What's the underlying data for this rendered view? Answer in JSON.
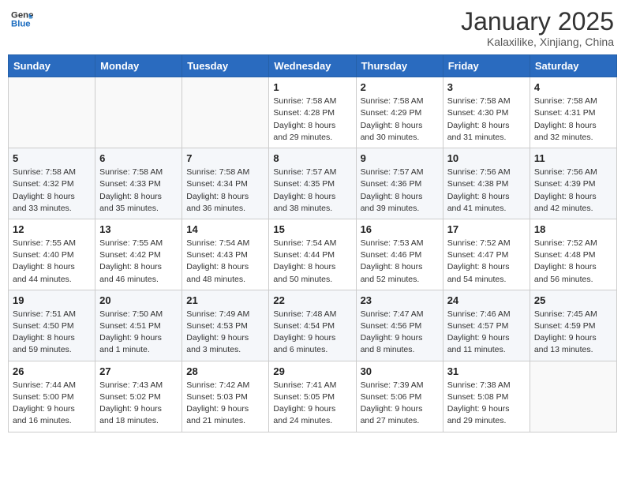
{
  "header": {
    "logo_general": "General",
    "logo_blue": "Blue",
    "month_title": "January 2025",
    "location": "Kalaxilike, Xinjiang, China"
  },
  "weekdays": [
    "Sunday",
    "Monday",
    "Tuesday",
    "Wednesday",
    "Thursday",
    "Friday",
    "Saturday"
  ],
  "weeks": [
    [
      {
        "day": "",
        "info": ""
      },
      {
        "day": "",
        "info": ""
      },
      {
        "day": "",
        "info": ""
      },
      {
        "day": "1",
        "info": "Sunrise: 7:58 AM\nSunset: 4:28 PM\nDaylight: 8 hours and 29 minutes."
      },
      {
        "day": "2",
        "info": "Sunrise: 7:58 AM\nSunset: 4:29 PM\nDaylight: 8 hours and 30 minutes."
      },
      {
        "day": "3",
        "info": "Sunrise: 7:58 AM\nSunset: 4:30 PM\nDaylight: 8 hours and 31 minutes."
      },
      {
        "day": "4",
        "info": "Sunrise: 7:58 AM\nSunset: 4:31 PM\nDaylight: 8 hours and 32 minutes."
      }
    ],
    [
      {
        "day": "5",
        "info": "Sunrise: 7:58 AM\nSunset: 4:32 PM\nDaylight: 8 hours and 33 minutes."
      },
      {
        "day": "6",
        "info": "Sunrise: 7:58 AM\nSunset: 4:33 PM\nDaylight: 8 hours and 35 minutes."
      },
      {
        "day": "7",
        "info": "Sunrise: 7:58 AM\nSunset: 4:34 PM\nDaylight: 8 hours and 36 minutes."
      },
      {
        "day": "8",
        "info": "Sunrise: 7:57 AM\nSunset: 4:35 PM\nDaylight: 8 hours and 38 minutes."
      },
      {
        "day": "9",
        "info": "Sunrise: 7:57 AM\nSunset: 4:36 PM\nDaylight: 8 hours and 39 minutes."
      },
      {
        "day": "10",
        "info": "Sunrise: 7:56 AM\nSunset: 4:38 PM\nDaylight: 8 hours and 41 minutes."
      },
      {
        "day": "11",
        "info": "Sunrise: 7:56 AM\nSunset: 4:39 PM\nDaylight: 8 hours and 42 minutes."
      }
    ],
    [
      {
        "day": "12",
        "info": "Sunrise: 7:55 AM\nSunset: 4:40 PM\nDaylight: 8 hours and 44 minutes."
      },
      {
        "day": "13",
        "info": "Sunrise: 7:55 AM\nSunset: 4:42 PM\nDaylight: 8 hours and 46 minutes."
      },
      {
        "day": "14",
        "info": "Sunrise: 7:54 AM\nSunset: 4:43 PM\nDaylight: 8 hours and 48 minutes."
      },
      {
        "day": "15",
        "info": "Sunrise: 7:54 AM\nSunset: 4:44 PM\nDaylight: 8 hours and 50 minutes."
      },
      {
        "day": "16",
        "info": "Sunrise: 7:53 AM\nSunset: 4:46 PM\nDaylight: 8 hours and 52 minutes."
      },
      {
        "day": "17",
        "info": "Sunrise: 7:52 AM\nSunset: 4:47 PM\nDaylight: 8 hours and 54 minutes."
      },
      {
        "day": "18",
        "info": "Sunrise: 7:52 AM\nSunset: 4:48 PM\nDaylight: 8 hours and 56 minutes."
      }
    ],
    [
      {
        "day": "19",
        "info": "Sunrise: 7:51 AM\nSunset: 4:50 PM\nDaylight: 8 hours and 59 minutes."
      },
      {
        "day": "20",
        "info": "Sunrise: 7:50 AM\nSunset: 4:51 PM\nDaylight: 9 hours and 1 minute."
      },
      {
        "day": "21",
        "info": "Sunrise: 7:49 AM\nSunset: 4:53 PM\nDaylight: 9 hours and 3 minutes."
      },
      {
        "day": "22",
        "info": "Sunrise: 7:48 AM\nSunset: 4:54 PM\nDaylight: 9 hours and 6 minutes."
      },
      {
        "day": "23",
        "info": "Sunrise: 7:47 AM\nSunset: 4:56 PM\nDaylight: 9 hours and 8 minutes."
      },
      {
        "day": "24",
        "info": "Sunrise: 7:46 AM\nSunset: 4:57 PM\nDaylight: 9 hours and 11 minutes."
      },
      {
        "day": "25",
        "info": "Sunrise: 7:45 AM\nSunset: 4:59 PM\nDaylight: 9 hours and 13 minutes."
      }
    ],
    [
      {
        "day": "26",
        "info": "Sunrise: 7:44 AM\nSunset: 5:00 PM\nDaylight: 9 hours and 16 minutes."
      },
      {
        "day": "27",
        "info": "Sunrise: 7:43 AM\nSunset: 5:02 PM\nDaylight: 9 hours and 18 minutes."
      },
      {
        "day": "28",
        "info": "Sunrise: 7:42 AM\nSunset: 5:03 PM\nDaylight: 9 hours and 21 minutes."
      },
      {
        "day": "29",
        "info": "Sunrise: 7:41 AM\nSunset: 5:05 PM\nDaylight: 9 hours and 24 minutes."
      },
      {
        "day": "30",
        "info": "Sunrise: 7:39 AM\nSunset: 5:06 PM\nDaylight: 9 hours and 27 minutes."
      },
      {
        "day": "31",
        "info": "Sunrise: 7:38 AM\nSunset: 5:08 PM\nDaylight: 9 hours and 29 minutes."
      },
      {
        "day": "",
        "info": ""
      }
    ]
  ]
}
